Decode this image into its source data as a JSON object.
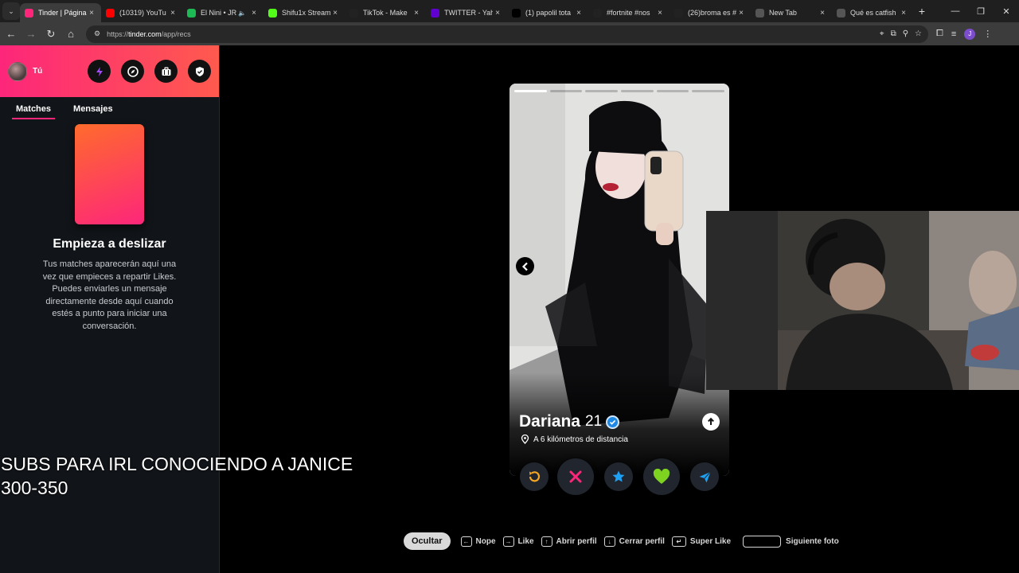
{
  "browser": {
    "tabs": [
      {
        "title": "Tinder | Página",
        "favicon": "tinder-flame-icon",
        "color": "#fd267a",
        "active": true
      },
      {
        "title": "(10319) YouTu",
        "favicon": "youtube-icon",
        "color": "#ff0000"
      },
      {
        "title": "El Nini • JR",
        "favicon": "spotify-icon",
        "color": "#1db954",
        "audio": true
      },
      {
        "title": "Shifu1x Stream",
        "favicon": "kick-icon",
        "color": "#53fc18"
      },
      {
        "title": "TikTok - Make",
        "favicon": "tiktok-icon",
        "color": "#222222"
      },
      {
        "title": "TWITTER - Yah",
        "favicon": "yahoo-icon",
        "color": "#6001d2"
      },
      {
        "title": "(1) papolil tota",
        "favicon": "x-icon",
        "color": "#000000"
      },
      {
        "title": "#fortnite #nos",
        "favicon": "tiktok-icon",
        "color": "#222222"
      },
      {
        "title": "(26)broma es #",
        "favicon": "tiktok-icon",
        "color": "#222222"
      },
      {
        "title": "New Tab",
        "favicon": "globe-icon",
        "color": "#555555"
      },
      {
        "title": "Qué es catfish",
        "favicon": "globe-icon",
        "color": "#555555"
      }
    ],
    "url_prefix": "https://",
    "url_host": "tinder.com",
    "url_path": "/app/recs",
    "profile_initial": "J"
  },
  "sidebar": {
    "user_name": "Tú",
    "tabs": [
      "Matches",
      "Mensajes"
    ],
    "empty_title": "Empieza a deslizar",
    "empty_desc": "Tus matches aparecerán aquí una vez que empieces a repartir Likes. Puedes enviarles un mensaje directamente desde aquí cuando estés a punto para iniciar una conversación."
  },
  "overlay_text": "SUBS PARA IRL CONOCIENDO A JANICE\n300-350",
  "profile": {
    "name": "Dariana",
    "age": "21",
    "distance": "A 6 kilómetros de distancia",
    "photo_count": 6,
    "photo_index": 1
  },
  "hints": {
    "hide": "Ocultar",
    "items": [
      "Nope",
      "Like",
      "Abrir perfil",
      "Cerrar perfil",
      "Super Like",
      "Siguiente foto"
    ]
  },
  "colors": {
    "brand_start": "#fd267a",
    "brand_end": "#ff5a4e",
    "rewind": "#f5a623",
    "nope": "#fd267a",
    "superlike": "#1ea1f2",
    "like": "#7ed321",
    "boost": "#1ea1f2"
  }
}
